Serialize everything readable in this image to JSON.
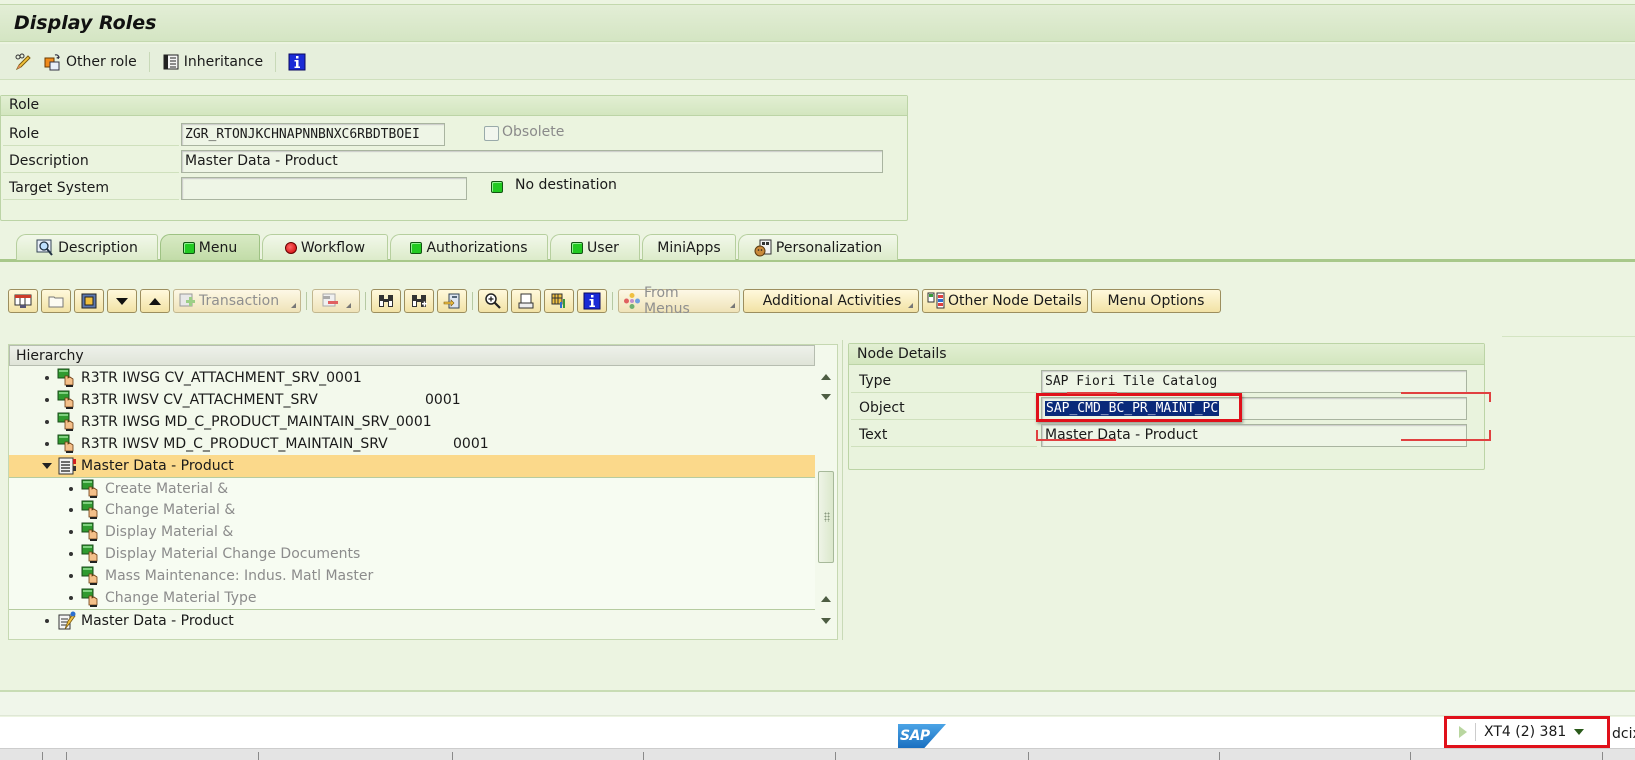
{
  "window": {
    "title": "Display Roles"
  },
  "app_toolbar": {
    "items": [
      {
        "icon": "pencil-glasses-icon",
        "label": ""
      },
      {
        "icon": "other-role-icon",
        "label": "Other role"
      },
      {
        "icon": "inheritance-icon",
        "label": "Inheritance"
      },
      {
        "icon": "info-icon",
        "label": ""
      }
    ]
  },
  "role_group": {
    "title": "Role",
    "role_label": "Role",
    "role_value": "ZGR_RTONJKCHNAPNNBNXC6RBDTBOEI",
    "obsolete_label": "Obsolete",
    "obsolete_checked": false,
    "description_label": "Description",
    "description_value": "Master Data - Product",
    "target_system_label": "Target System",
    "target_system_value": "",
    "destination_status": "No destination",
    "destination_status_color": "#22c922"
  },
  "tabs": [
    {
      "label": "Description",
      "icon": "magnifier-document-icon",
      "active": false
    },
    {
      "label": "Menu",
      "icon": "green-status-icon",
      "active": true
    },
    {
      "label": "Workflow",
      "icon": "red-status-icon",
      "active": false
    },
    {
      "label": "Authorizations",
      "icon": "green-status-icon",
      "active": false
    },
    {
      "label": "User",
      "icon": "green-status-icon",
      "active": false
    },
    {
      "label": "MiniApps",
      "icon": "",
      "active": false
    },
    {
      "label": "Personalization",
      "icon": "personalization-icon",
      "active": false
    }
  ],
  "menu_toolbar": {
    "transaction_label": "Transaction",
    "from_menus_label": "From Menus",
    "additional_activities_label": "Additional Activities",
    "other_node_details_label": "Other Node Details",
    "menu_options_label": "Menu Options"
  },
  "hierarchy": {
    "title": "Hierarchy",
    "rows": [
      {
        "text": "R3TR IWSG CV_ATTACHMENT_SRV_0001",
        "suffix": "",
        "level": 1,
        "icon": "service-icon",
        "selected": false,
        "dimmed": false
      },
      {
        "text": "R3TR IWSV CV_ATTACHMENT_SRV",
        "suffix": "0001",
        "level": 1,
        "icon": "service-icon",
        "selected": false,
        "dimmed": false
      },
      {
        "text": "R3TR IWSG MD_C_PRODUCT_MAINTAIN_SRV_0001",
        "suffix": "",
        "level": 1,
        "icon": "service-icon",
        "selected": false,
        "dimmed": false
      },
      {
        "text": "R3TR IWSV MD_C_PRODUCT_MAINTAIN_SRV",
        "suffix": "0001",
        "level": 1,
        "icon": "service-icon",
        "selected": false,
        "dimmed": false
      },
      {
        "text": "Master Data - Product",
        "suffix": "",
        "level": 1,
        "icon": "catalog-icon",
        "selected": true,
        "expanded": true,
        "dimmed": false
      },
      {
        "text": "Create Material &",
        "suffix": "",
        "level": 2,
        "icon": "service-icon",
        "selected": false,
        "dimmed": true
      },
      {
        "text": "Change Material &",
        "suffix": "",
        "level": 2,
        "icon": "service-icon",
        "selected": false,
        "dimmed": true
      },
      {
        "text": "Display Material &",
        "suffix": "",
        "level": 2,
        "icon": "service-icon",
        "selected": false,
        "dimmed": true
      },
      {
        "text": "Display Material Change Documents",
        "suffix": "",
        "level": 2,
        "icon": "service-icon",
        "selected": false,
        "dimmed": true
      },
      {
        "text": "Mass Maintenance: Indus. Matl Master",
        "suffix": "",
        "level": 2,
        "icon": "service-icon",
        "selected": false,
        "dimmed": true
      },
      {
        "text": "Change Material Type",
        "suffix": "",
        "level": 2,
        "icon": "service-icon",
        "selected": false,
        "dimmed": true
      },
      {
        "text": "Master Data - Product",
        "suffix": "",
        "level": 1,
        "icon": "group-edit-icon",
        "selected": false,
        "dimmed": false
      }
    ]
  },
  "node_details": {
    "title": "Node Details",
    "type_label": "Type",
    "type_value": "SAP Fiori Tile Catalog",
    "object_label": "Object",
    "object_value": "SAP_CMD_BC_PR_MAINT_PC",
    "text_label": "Text",
    "text_value": "Master Data - Product"
  },
  "footer": {
    "logo_text": "SAP",
    "system_info": "XT4 (2) 381",
    "host_fragment": "dcix",
    "highlight_color": "#e0101a"
  }
}
